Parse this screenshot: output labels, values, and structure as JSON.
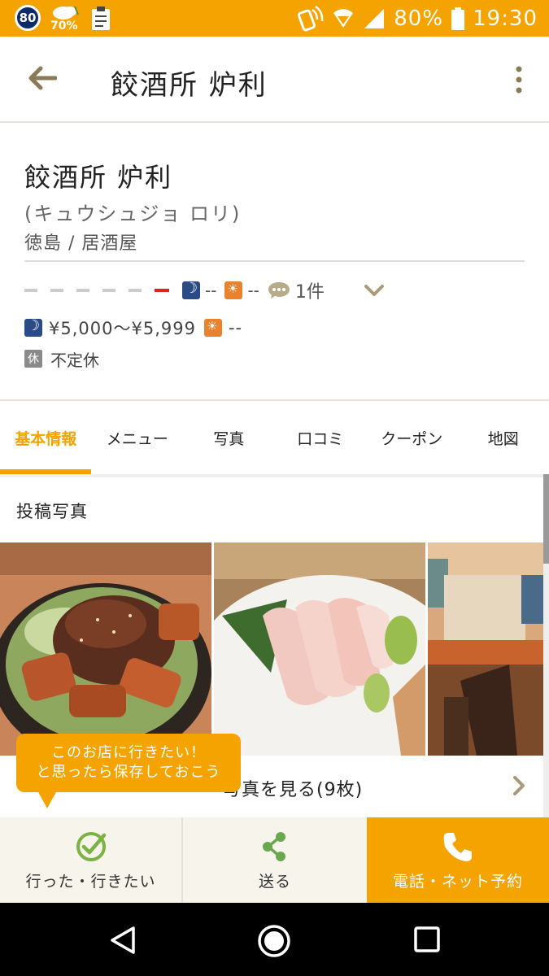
{
  "status_bar": {
    "badge": "80",
    "weather_pct": "70%",
    "battery_pct": "80%",
    "time": "19:30"
  },
  "app_bar": {
    "title": "餃酒所 炉利"
  },
  "shop": {
    "name": "餃酒所 炉利",
    "kana": "(キュウシュジョ ロリ)",
    "category": "徳島 / 居酒屋",
    "rating": {
      "dinner_score": "--",
      "lunch_score": "--",
      "review_count": "1件"
    },
    "budget": {
      "dinner": "¥5,000～¥5,999",
      "lunch": "--"
    },
    "holiday_icon": "休",
    "holiday": "不定休"
  },
  "tabs": [
    {
      "label": "基本情報",
      "active": true
    },
    {
      "label": "メニュー",
      "active": false
    },
    {
      "label": "写真",
      "active": false
    },
    {
      "label": "口コミ",
      "active": false
    },
    {
      "label": "クーポン",
      "active": false
    },
    {
      "label": "地図",
      "active": false
    }
  ],
  "photos": {
    "section_title": "投稿写真",
    "see_all_label": "写真を見る(9枚)"
  },
  "tooltip": {
    "line1": "このお店に行きたい！",
    "line2": "と思ったら保存しておこう"
  },
  "actions": {
    "went_label": "行った・行きたい",
    "send_label": "送る",
    "call_label": "電話・ネット予約"
  },
  "colors": {
    "accent": "#f5a300",
    "dinner": "#2a4a88",
    "lunch": "#e8822c",
    "went_check": "#7cb342",
    "share": "#6aa84f"
  }
}
